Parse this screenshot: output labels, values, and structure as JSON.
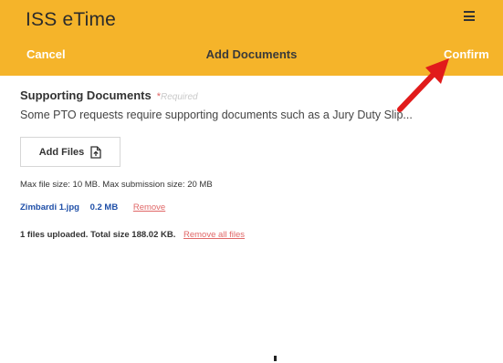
{
  "app": {
    "title": "ISS eTime"
  },
  "header": {
    "cancel_label": "Cancel",
    "title": "Add Documents",
    "confirm_label": "Confirm"
  },
  "icons": {
    "menu": "hamburger-menu-icon",
    "upload": "file-upload-icon",
    "annotation": "red-arrow-icon"
  },
  "section": {
    "title": "Supporting Documents",
    "required_star": "*",
    "required_text": "Required",
    "description": "Some PTO requests require supporting documents such as a Jury Duty Slip..."
  },
  "upload": {
    "add_files_label": "Add Files",
    "limits": "Max file size: 10 MB. Max submission size: 20 MB"
  },
  "files": [
    {
      "name": "Zimbardi 1.jpg",
      "size": "0.2 MB",
      "remove_label": "Remove"
    }
  ],
  "summary": {
    "text": "1 files uploaded. Total size 188.02 KB.",
    "remove_all_label": "Remove all files"
  },
  "colors": {
    "header_bg": "#f5b42a",
    "link_blue": "#1f4fa8",
    "remove_red": "#e06767",
    "arrow_red": "#e11b1b"
  }
}
